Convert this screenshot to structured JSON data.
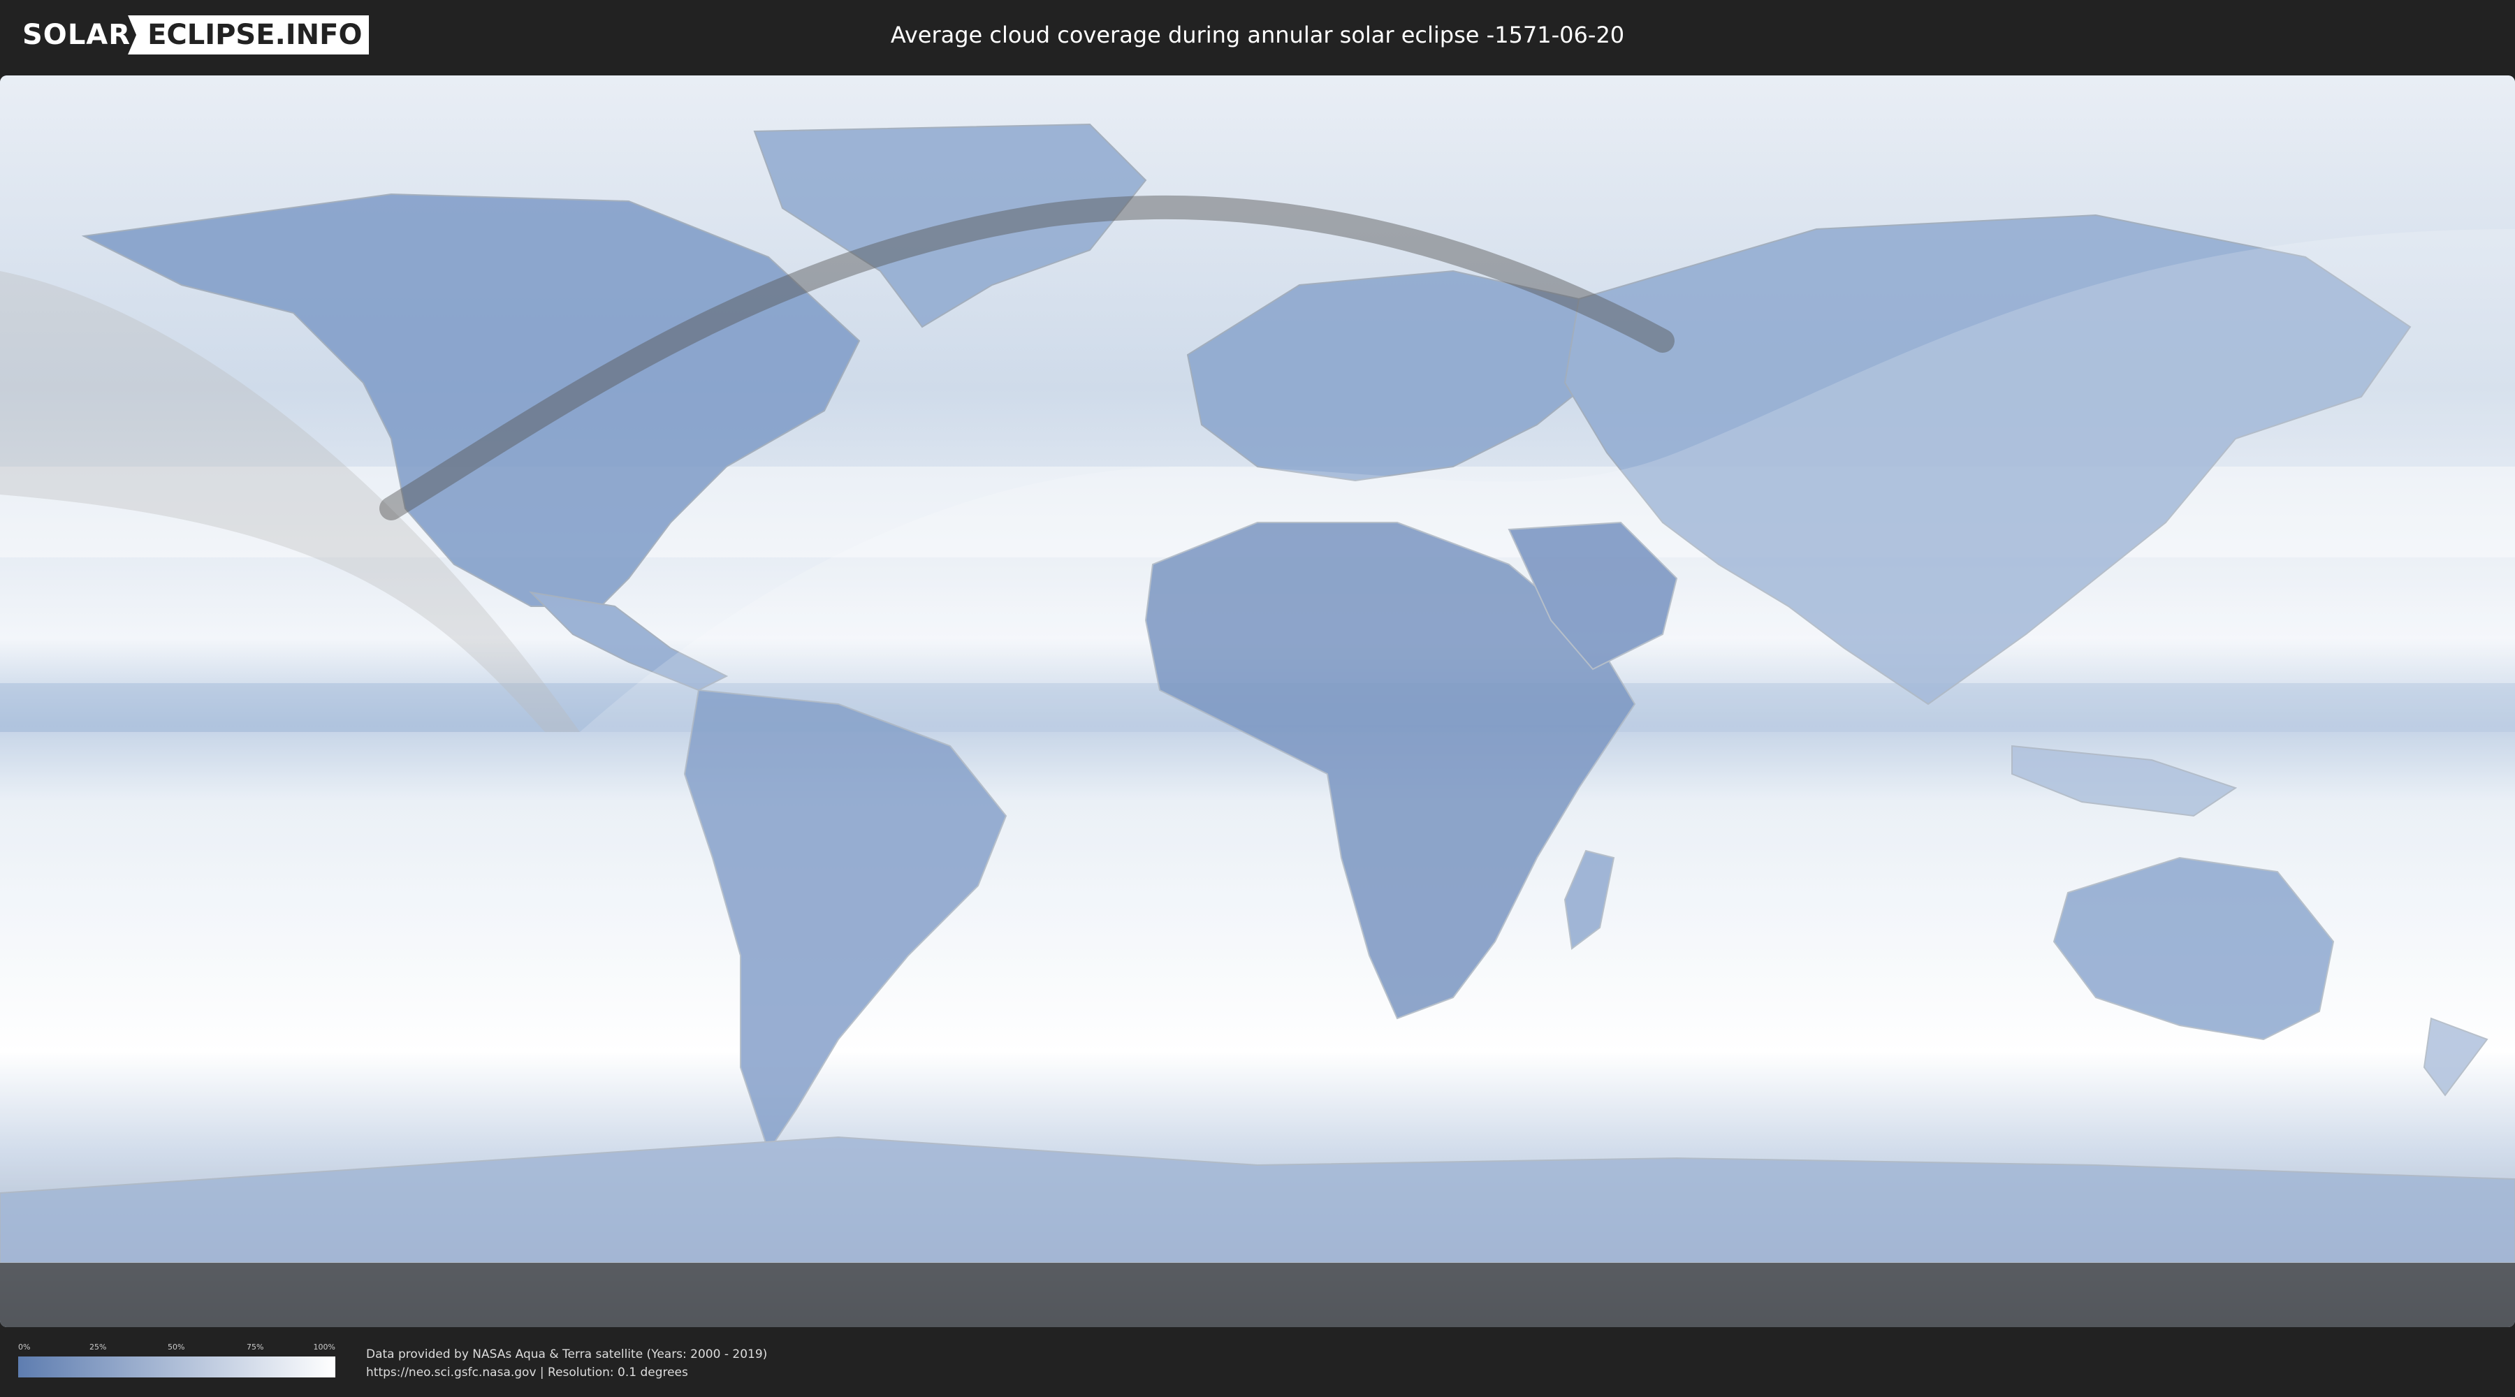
{
  "header": {
    "logo_left": "SOLAR",
    "logo_right": "ECLIPSE.INFO",
    "title": "Average cloud coverage during annular solar eclipse -1571-06-20"
  },
  "map": {
    "ocean_color": "#dfe7f1",
    "land_cloud_color": "#6f8fbf",
    "clear_sky_color": "#ffffff",
    "eclipse_path_color": "#555555",
    "polar_night_color": "#444444"
  },
  "legend": {
    "ticks": [
      "0%",
      "25%",
      "50%",
      "75%",
      "100%"
    ],
    "gradient_start": "#5e7db0",
    "gradient_end": "#ffffff"
  },
  "footer": {
    "credit_line1": "Data provided by NASAs Aqua & Terra satellite (Years: 2000 - 2019)",
    "credit_line2": "https://neo.sci.gsfc.nasa.gov | Resolution: 0.1 degrees"
  }
}
